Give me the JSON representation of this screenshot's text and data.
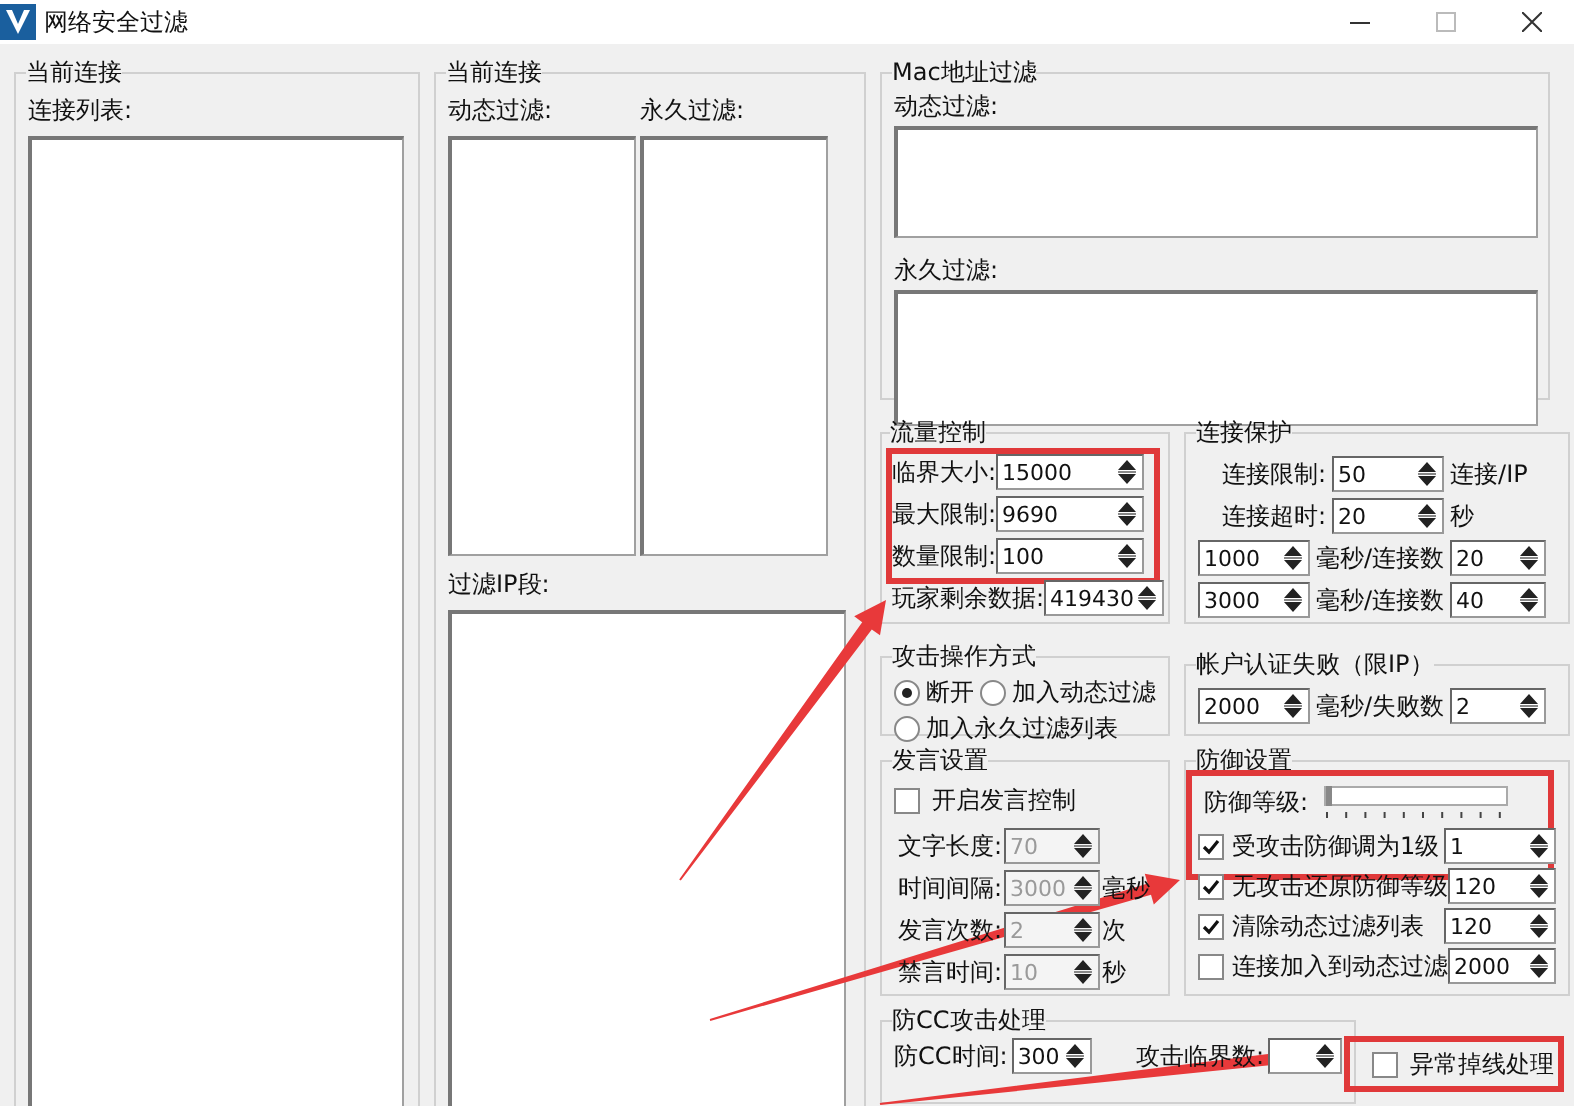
{
  "window": {
    "title": "网络安全过滤"
  },
  "connections": {
    "label": "当前连接",
    "list_label": "连接列表:"
  },
  "filters": {
    "label": "当前连接",
    "dynamic_label": "动态过滤:",
    "permanent_label": "永久过滤:",
    "ip_label": "过滤IP段:"
  },
  "mac_filter": {
    "label": "Mac地址过滤",
    "dynamic_label": "动态过滤:",
    "permanent_label": "永久过滤:"
  },
  "traffic": {
    "label": "流量控制",
    "fields": [
      {
        "label": "临界大小:",
        "value": "15000"
      },
      {
        "label": "最大限制:",
        "value": "9690"
      },
      {
        "label": "数量限制:",
        "value": "100"
      },
      {
        "label": "玩家剩余数据:",
        "value": "419430"
      }
    ]
  },
  "connection_protection": {
    "label": "连接保护",
    "rows": [
      {
        "kind": "labeled",
        "label": "连接限制:",
        "value": "50",
        "unit": "连接/IP"
      },
      {
        "kind": "labeled",
        "label": "连接超时:",
        "value": "20",
        "unit": "秒"
      },
      {
        "kind": "pair",
        "value": "1000",
        "unit": "毫秒/连接数",
        "value2": "20"
      },
      {
        "kind": "pair",
        "value": "3000",
        "unit": "毫秒/连接数",
        "value2": "40"
      }
    ]
  },
  "attack_action": {
    "label": "攻击操作方式",
    "options": [
      {
        "label": "断开",
        "selected": true
      },
      {
        "label": "加入动态过滤",
        "selected": false
      },
      {
        "label": "加入永久过滤列表",
        "selected": false
      }
    ]
  },
  "auth_failure": {
    "label": "帐户认证失败（限IP）",
    "value": "2000",
    "unit": "毫秒/失败数",
    "value2": "2"
  },
  "speech": {
    "label": "发言设置",
    "enable": {
      "label": "开启发言控制",
      "checked": false
    },
    "fields": [
      {
        "label": "文字长度:",
        "value": "70"
      },
      {
        "label": "时间间隔:",
        "value": "3000",
        "unit": "毫秒"
      },
      {
        "label": "发言次数:",
        "value": "2",
        "unit": "次"
      },
      {
        "label": "禁言时间:",
        "value": "10",
        "unit": "秒"
      }
    ]
  },
  "defense": {
    "label": "防御设置",
    "level_label": "防御等级:",
    "level": 0,
    "options": [
      {
        "label": "受攻击防御调为1级",
        "checked": true,
        "value": "1"
      },
      {
        "label": "无攻击还原防御等级",
        "checked": true,
        "value": "120"
      },
      {
        "label": "清除动态过滤列表",
        "checked": true,
        "value": "120"
      },
      {
        "label": "连接加入到动态过滤",
        "checked": false,
        "value": "2000"
      }
    ]
  },
  "cc": {
    "label": "防CC攻击处理",
    "time_label": "防CC时间:",
    "time_value": "300",
    "threshold_label": "攻击临界数:"
  },
  "abnormal_disconnect": {
    "label": "异常掉线处理",
    "checked": false
  }
}
